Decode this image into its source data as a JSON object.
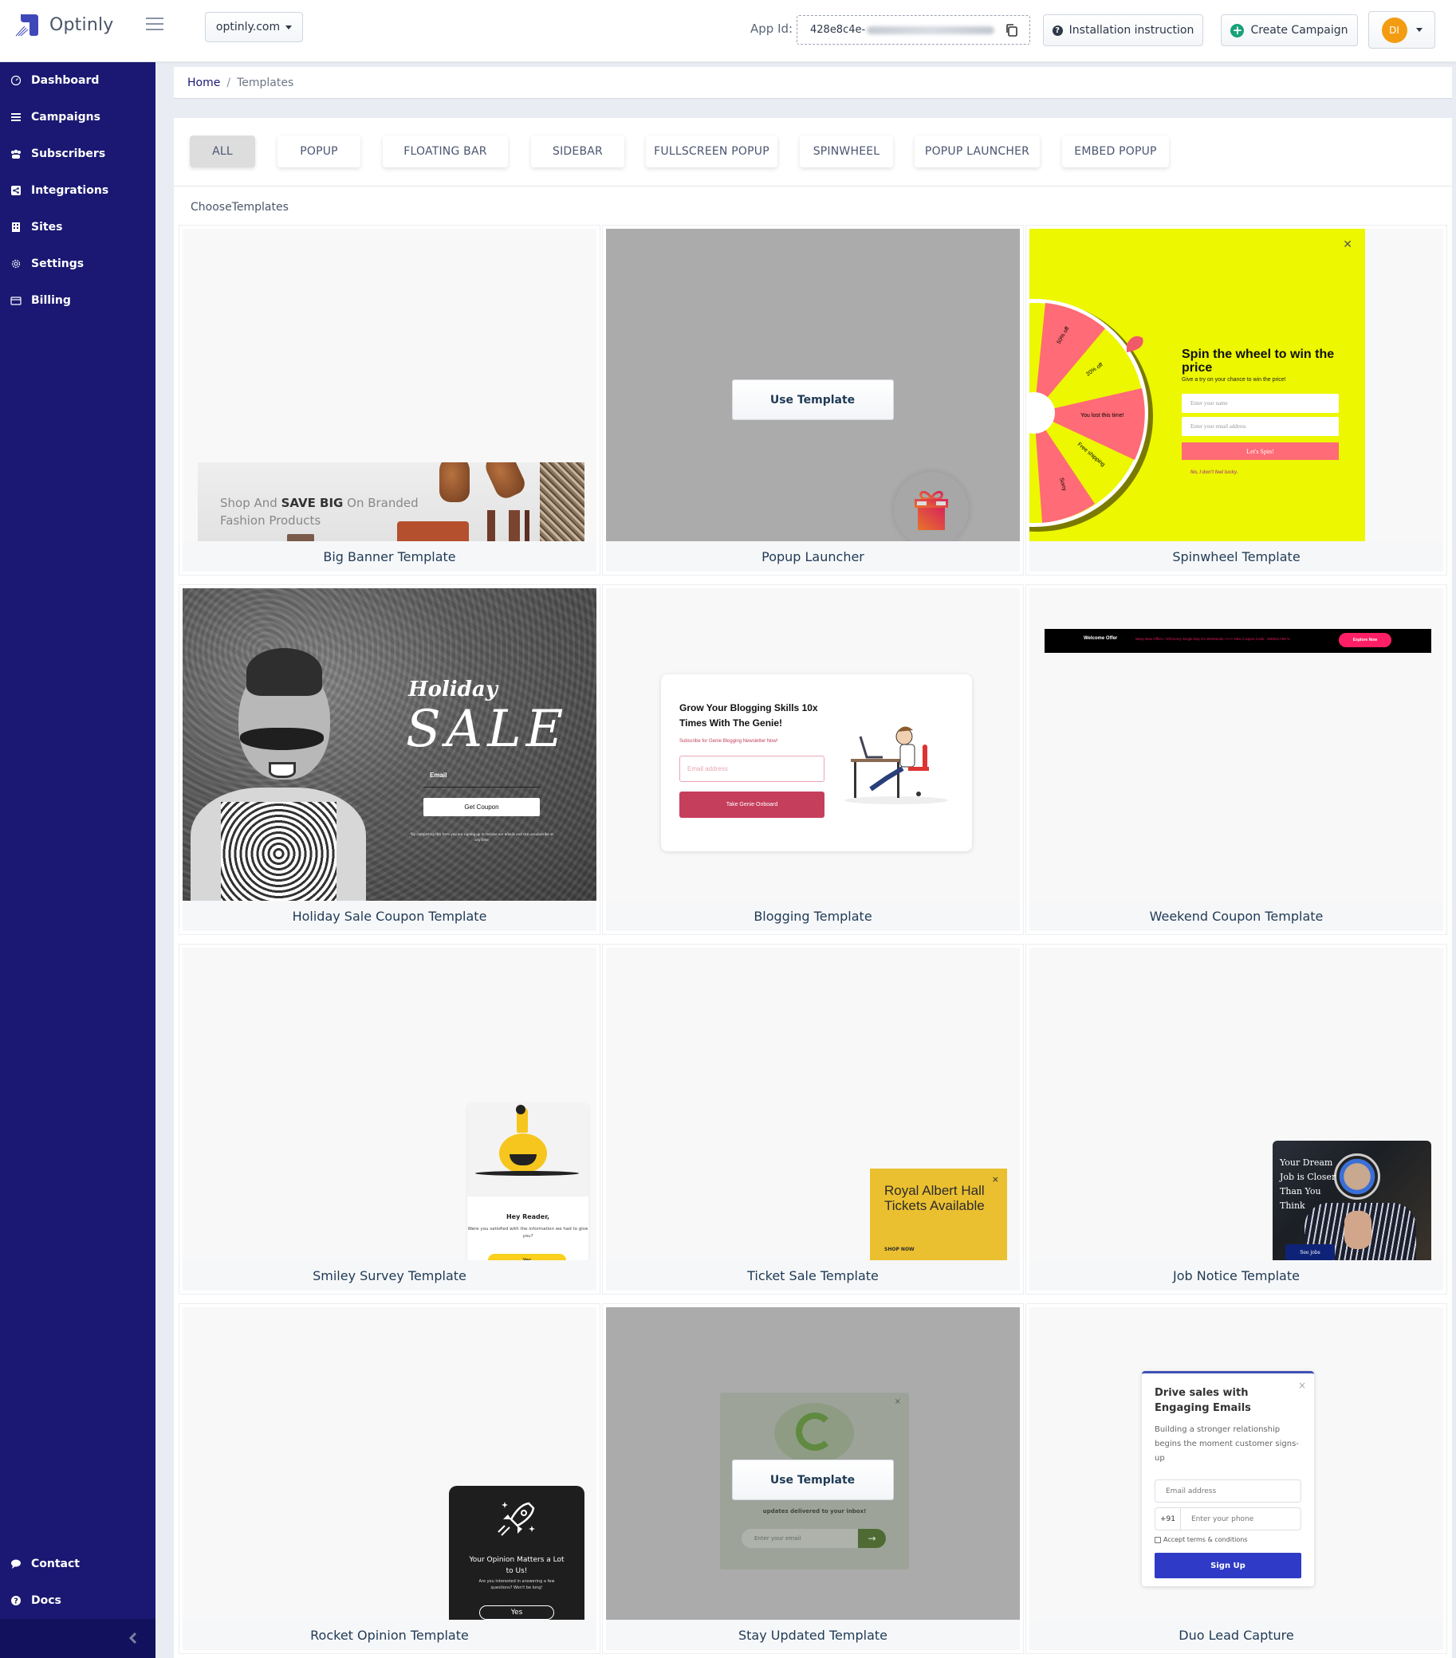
{
  "app": {
    "brand": "Optinly",
    "site_selector": "optinly.com",
    "app_id_label": "App Id:",
    "app_id_value": "428e8c4e-",
    "install_button": "Installation instruction",
    "create_button": "Create Campaign",
    "avatar_initials": "DI"
  },
  "sidebar": {
    "items": [
      {
        "label": "Dashboard",
        "icon": "dashboard-icon"
      },
      {
        "label": "Campaigns",
        "icon": "list-icon"
      },
      {
        "label": "Subscribers",
        "icon": "users-icon"
      },
      {
        "label": "Integrations",
        "icon": "share-icon"
      },
      {
        "label": "Sites",
        "icon": "building-icon"
      },
      {
        "label": "Settings",
        "icon": "gear-icon"
      },
      {
        "label": "Billing",
        "icon": "credit-card-icon"
      }
    ],
    "bottom_items": [
      {
        "label": "Contact",
        "icon": "comment-icon"
      },
      {
        "label": "Docs",
        "icon": "question-circle-icon"
      }
    ]
  },
  "breadcrumb": {
    "home": "Home",
    "separator": "/",
    "current": "Templates"
  },
  "filters": {
    "tabs": [
      "ALL",
      "POPUP",
      "FLOATING BAR",
      "SIDEBAR",
      "FULLSCREEN POPUP",
      "SPINWHEEL",
      "POPUP LAUNCHER",
      "EMBED POPUP"
    ],
    "active": "ALL"
  },
  "section_label": "ChooseTemplates",
  "use_template_label": "Use Template",
  "templates": [
    {
      "title": "Big Banner Template"
    },
    {
      "title": "Popup Launcher"
    },
    {
      "title": "Spinwheel Template"
    },
    {
      "title": "Holiday Sale Coupon Template"
    },
    {
      "title": "Blogging Template"
    },
    {
      "title": "Weekend Coupon Template"
    },
    {
      "title": "Smiley Survey Template"
    },
    {
      "title": "Ticket Sale Template"
    },
    {
      "title": "Job Notice Template"
    },
    {
      "title": "Rocket Opinion Template"
    },
    {
      "title": "Stay Updated Template"
    },
    {
      "title": "Duo Lead Capture"
    }
  ],
  "previews": {
    "banner": {
      "pre": "Shop And ",
      "bold": "SAVE BIG",
      "post": " On Branded",
      "line2": "Fashion Products"
    },
    "spin": {
      "title": "Spin the wheel to win the price",
      "subtitle": "Give a try on your chance to win the price!",
      "name_placeholder": "Enter your name",
      "email_placeholder": "Enter your email address",
      "button": "Let's Spin!",
      "decline": "No, I don't feel lucky.",
      "segments": [
        "50% off",
        "20% off",
        "You lost this time!",
        "Free shipping",
        "Sorry"
      ]
    },
    "holiday": {
      "script": "Holiday",
      "sale": "SALE",
      "email_label": "Email",
      "button": "Get Coupon",
      "fine_print": "*By completing this form you are signing up to receive our emails and can unsubscribe at any time"
    },
    "blog": {
      "title": "Grow Your Blogging Skills 10x Times With The Genie!",
      "subtitle": "Subscribe for Genie Blogging Newsletter Now!",
      "email_placeholder": "Email address",
      "button": "Take Genie Onboard"
    },
    "weekend": {
      "label": "Welcome Offer",
      "message": "Warp New Offers / Gift Every Single Day On Weekends >>>> New Coupon Code : WEEKLY55 %",
      "button": "Explore Now"
    },
    "smiley": {
      "greeting": "Hey Reader,",
      "question": "Were you satisfied with the information we had to give you?",
      "button": "Yes"
    },
    "ticket": {
      "title": "Royal Albert Hall Tickets Available",
      "cta": "SHOP NOW",
      "close": "×"
    },
    "job": {
      "headline": "Your Dream Job is Closer Than You Think",
      "button": "See jobs"
    },
    "rocket": {
      "title": "Your Opinion Matters a Lot to Us!",
      "subtitle": "Are you interested in answering a few questions? Won't be long!",
      "button": "Yes"
    },
    "stay": {
      "text": "updates delivered to your inbox!",
      "email_placeholder": "Enter your email",
      "close": "×"
    },
    "duo": {
      "title": "Drive sales with Engaging Emails",
      "subtitle": "Building a stronger relationship begins the moment customer signs-up",
      "email_placeholder": "Email address",
      "country_code": "+91",
      "phone_placeholder": "Enter your phone",
      "terms": "Accept terms & conditions",
      "button": "Sign Up",
      "close": "×"
    }
  },
  "colors": {
    "sidebar": "#1a1872",
    "accent_create": "#17a27a",
    "avatar": "#f39c12",
    "spin_bg": "#ecf700",
    "spin_accent": "#ff6b76"
  }
}
